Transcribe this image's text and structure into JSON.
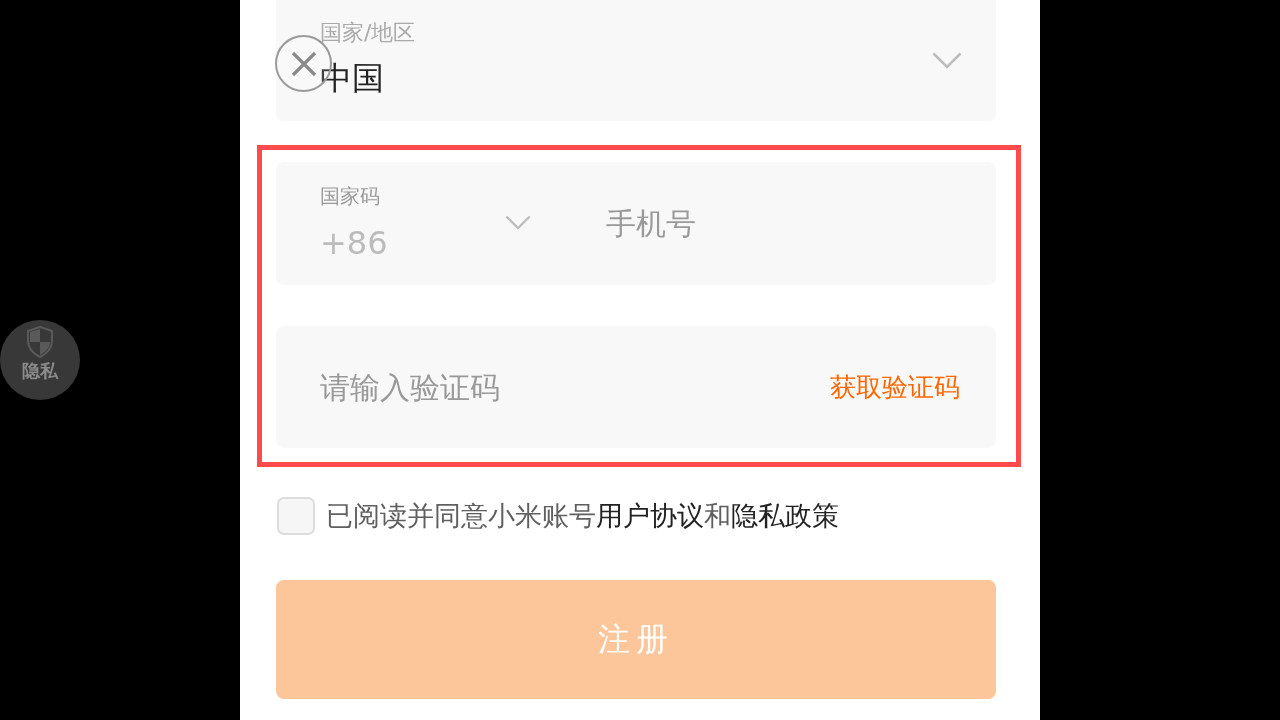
{
  "country_field": {
    "label": "国家/地区",
    "value": "中国"
  },
  "privacy_button": {
    "label": "隐私"
  },
  "phone_group": {
    "highlighted": true,
    "country_code": {
      "label": "国家码",
      "value": "+86"
    },
    "phone": {
      "placeholder": "手机号"
    },
    "code": {
      "placeholder": "请输入验证码",
      "action": "获取验证码"
    }
  },
  "agreement": {
    "checked": false,
    "parts": [
      {
        "kind": "plain",
        "text": "已阅读并同意小米账号"
      },
      {
        "kind": "link",
        "text": "用户协议"
      },
      {
        "kind": "plain",
        "text": "和"
      },
      {
        "kind": "link",
        "text": "隐私政策"
      }
    ]
  },
  "register_button": {
    "label": "注册",
    "disabled": true
  }
}
